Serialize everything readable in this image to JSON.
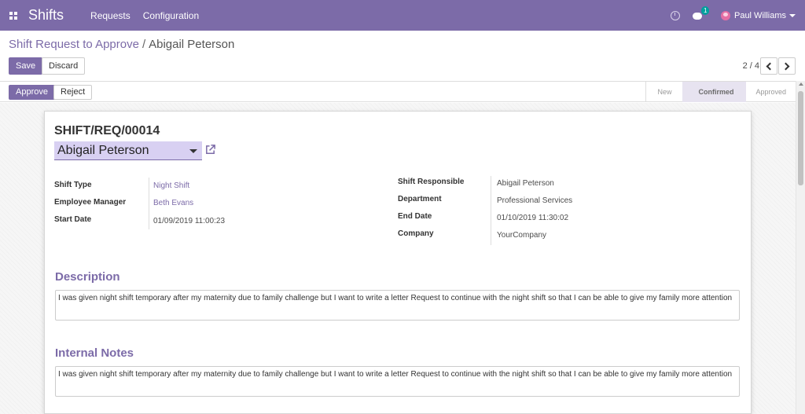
{
  "navbar": {
    "app_title": "Shifts",
    "menu": [
      "Requests",
      "Configuration"
    ],
    "chat_badge": "1",
    "user_name": "Paul Williams"
  },
  "breadcrumb": {
    "parent": "Shift Request to Approve",
    "separator": "/",
    "current": "Abigail Peterson"
  },
  "buttons": {
    "save": "Save",
    "discard": "Discard",
    "approve": "Approve",
    "reject": "Reject"
  },
  "pager": {
    "label": "2 / 4"
  },
  "status": {
    "stages": [
      "New",
      "Confirmed",
      "Approved"
    ],
    "active": "Confirmed"
  },
  "form": {
    "reference": "SHIFT/REQ/00014",
    "employee": "Abigail Peterson",
    "left_fields": [
      {
        "label": "Shift Type",
        "value": "Night Shift"
      },
      {
        "label": "Employee Manager",
        "value": "Beth Evans"
      },
      {
        "label": "Start Date",
        "value": "01/09/2019 11:00:23"
      }
    ],
    "right_fields": [
      {
        "label": "Shift Responsible",
        "value": "Abigail Peterson"
      },
      {
        "label": "Department",
        "value": "Professional Services"
      },
      {
        "label": "End Date",
        "value": "01/10/2019 11:30:02"
      },
      {
        "label": "Company",
        "value": "YourCompany"
      }
    ],
    "description_title": "Description",
    "description": "I was given night shift temporary after my maternity due to family challenge but I want to write a letter Request to continue with the night shift so that I can be able to give my family more attention",
    "notes_title": "Internal Notes",
    "notes": "I was given night shift temporary after my maternity due to family challenge but I want to write a letter Request to continue with the night shift so that I can be able to give my family more attention"
  },
  "colors": {
    "brand": "#7c6ba8",
    "badge": "#00a09d"
  }
}
